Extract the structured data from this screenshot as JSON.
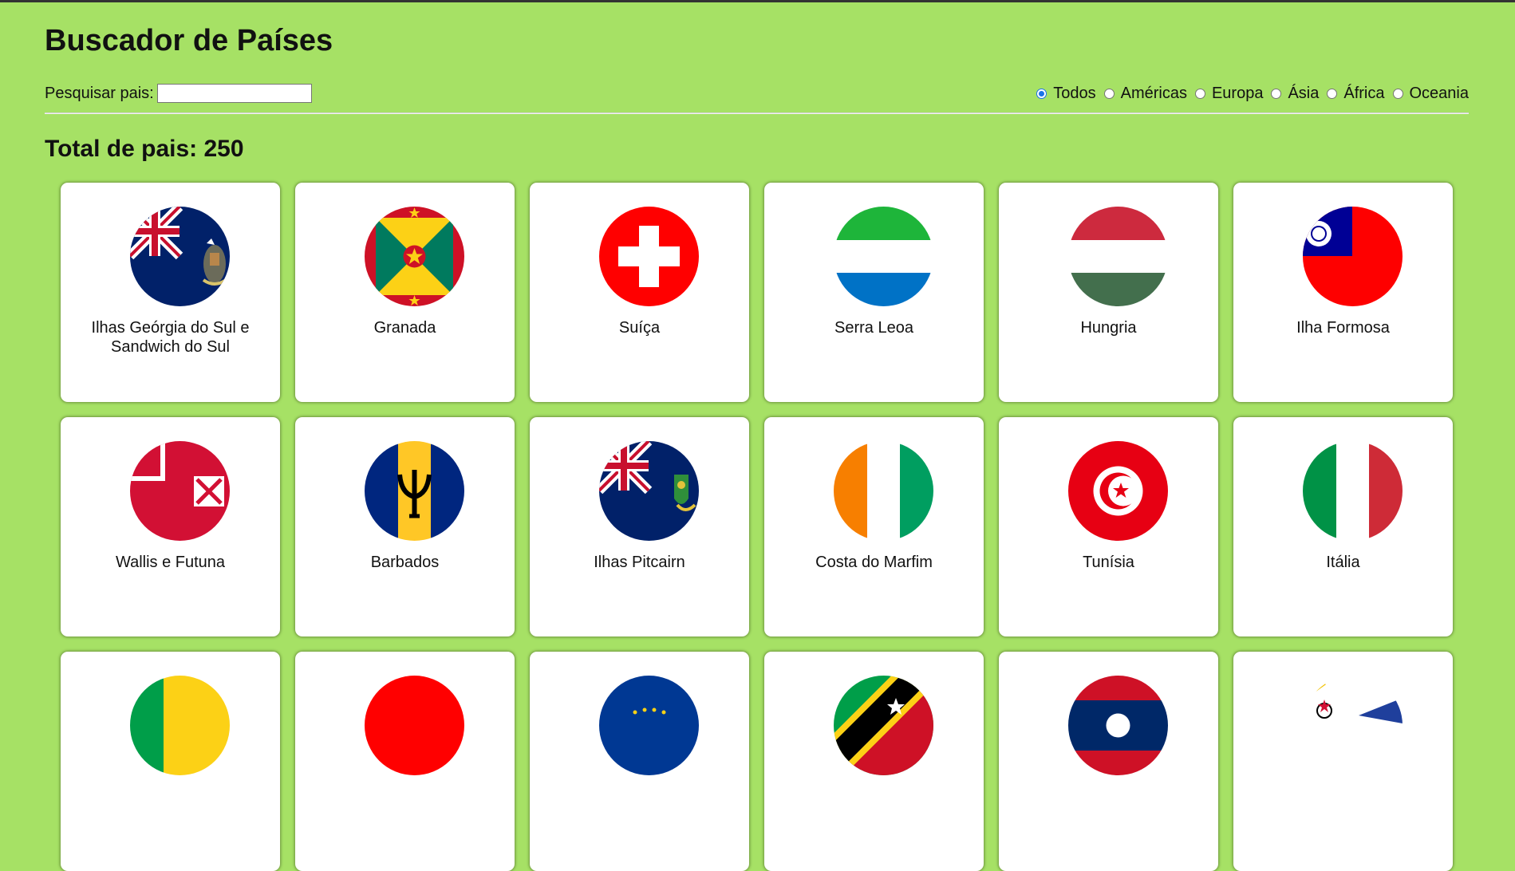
{
  "header": {
    "title": "Buscador de Países"
  },
  "search": {
    "label": "Pesquisar pais:",
    "value": "",
    "placeholder": ""
  },
  "filters": {
    "selected": "Todos",
    "options": [
      "Todos",
      "Américas",
      "Europa",
      "Ásia",
      "África",
      "Oceania"
    ]
  },
  "summary": {
    "label": "Total de pais:",
    "count": "250"
  },
  "countries": [
    {
      "name": "Ilhas Geórgia do Sul e Sandwich do Sul",
      "flag": "south-georgia-flag-icon"
    },
    {
      "name": "Granada",
      "flag": "grenada-flag-icon"
    },
    {
      "name": "Suíça",
      "flag": "switzerland-flag-icon"
    },
    {
      "name": "Serra Leoa",
      "flag": "sierra-leone-flag-icon"
    },
    {
      "name": "Hungria",
      "flag": "hungary-flag-icon"
    },
    {
      "name": "Ilha Formosa",
      "flag": "taiwan-flag-icon"
    },
    {
      "name": "Wallis e Futuna",
      "flag": "wallis-futuna-flag-icon"
    },
    {
      "name": "Barbados",
      "flag": "barbados-flag-icon"
    },
    {
      "name": "Ilhas Pitcairn",
      "flag": "pitcairn-flag-icon"
    },
    {
      "name": "Costa do Marfim",
      "flag": "ivory-coast-flag-icon"
    },
    {
      "name": "Tunísia",
      "flag": "tunisia-flag-icon"
    },
    {
      "name": "Itália",
      "flag": "italy-flag-icon"
    },
    {
      "name": "",
      "flag": "green-yellow-flag-icon"
    },
    {
      "name": "",
      "flag": "red-flag-icon"
    },
    {
      "name": "",
      "flag": "blue-stars-flag-icon"
    },
    {
      "name": "",
      "flag": "saint-kitts-nevis-flag-icon"
    },
    {
      "name": "",
      "flag": "laos-flag-icon"
    },
    {
      "name": "",
      "flag": "white-emblem-flag-icon"
    }
  ],
  "colors": {
    "background": "#a6e165",
    "card": "#ffffff",
    "radio_accent": "#1a73e8"
  }
}
